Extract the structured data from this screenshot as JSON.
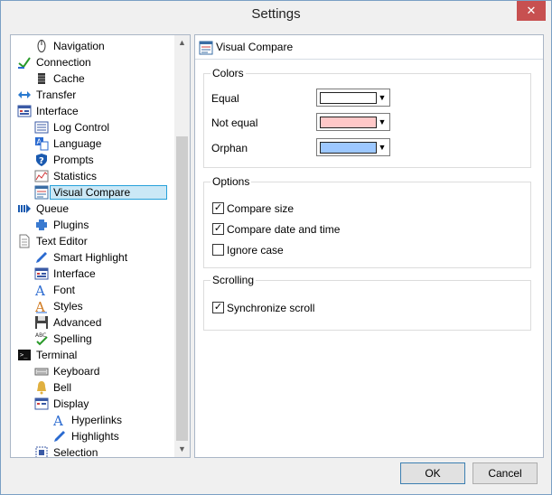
{
  "window": {
    "title": "Settings",
    "close_glyph": "✕"
  },
  "tree": [
    {
      "label": "Navigation",
      "indent": 1,
      "icon": "mouse-icon"
    },
    {
      "label": "Connection",
      "indent": 0,
      "icon": "connection-icon"
    },
    {
      "label": "Cache",
      "indent": 1,
      "icon": "cache-icon"
    },
    {
      "label": "Transfer",
      "indent": 0,
      "icon": "transfer-icon"
    },
    {
      "label": "Interface",
      "indent": 0,
      "icon": "interface-icon"
    },
    {
      "label": "Log Control",
      "indent": 1,
      "icon": "log-icon"
    },
    {
      "label": "Language",
      "indent": 1,
      "icon": "language-icon"
    },
    {
      "label": "Prompts",
      "indent": 1,
      "icon": "question-icon"
    },
    {
      "label": "Statistics",
      "indent": 1,
      "icon": "statistics-icon"
    },
    {
      "label": "Visual Compare",
      "indent": 1,
      "icon": "visual-compare-icon",
      "selected": true
    },
    {
      "label": "Queue",
      "indent": 0,
      "icon": "queue-icon"
    },
    {
      "label": "Plugins",
      "indent": 1,
      "icon": "plugin-icon"
    },
    {
      "label": "Text Editor",
      "indent": 0,
      "icon": "document-icon"
    },
    {
      "label": "Smart Highlight",
      "indent": 1,
      "icon": "pen-icon"
    },
    {
      "label": "Interface",
      "indent": 1,
      "icon": "interface-icon"
    },
    {
      "label": "Font",
      "indent": 1,
      "icon": "font-icon"
    },
    {
      "label": "Styles",
      "indent": 1,
      "icon": "styles-icon"
    },
    {
      "label": "Advanced",
      "indent": 1,
      "icon": "save-icon"
    },
    {
      "label": "Spelling",
      "indent": 1,
      "icon": "spelling-icon"
    },
    {
      "label": "Terminal",
      "indent": 0,
      "icon": "terminal-icon"
    },
    {
      "label": "Keyboard",
      "indent": 1,
      "icon": "keyboard-icon"
    },
    {
      "label": "Bell",
      "indent": 1,
      "icon": "bell-icon"
    },
    {
      "label": "Display",
      "indent": 1,
      "icon": "display-icon"
    },
    {
      "label": "Hyperlinks",
      "indent": 2,
      "icon": "font-icon"
    },
    {
      "label": "Highlights",
      "indent": 2,
      "icon": "pen-icon"
    },
    {
      "label": "Selection",
      "indent": 1,
      "icon": "selection-icon"
    }
  ],
  "panel": {
    "title": "Visual Compare",
    "colors": {
      "title": "Colors",
      "rows": [
        {
          "label": "Equal",
          "color": "#ffffff"
        },
        {
          "label": "Not equal",
          "color": "#ffc8c8"
        },
        {
          "label": "Orphan",
          "color": "#9dc8ff"
        }
      ]
    },
    "options": {
      "title": "Options",
      "items": [
        {
          "label": "Compare size",
          "checked": true
        },
        {
          "label": "Compare date and time",
          "checked": true
        },
        {
          "label": "Ignore case",
          "checked": false
        }
      ]
    },
    "scrolling": {
      "title": "Scrolling",
      "items": [
        {
          "label": "Synchronize scroll",
          "checked": true
        }
      ]
    }
  },
  "buttons": {
    "ok": "OK",
    "cancel": "Cancel"
  }
}
